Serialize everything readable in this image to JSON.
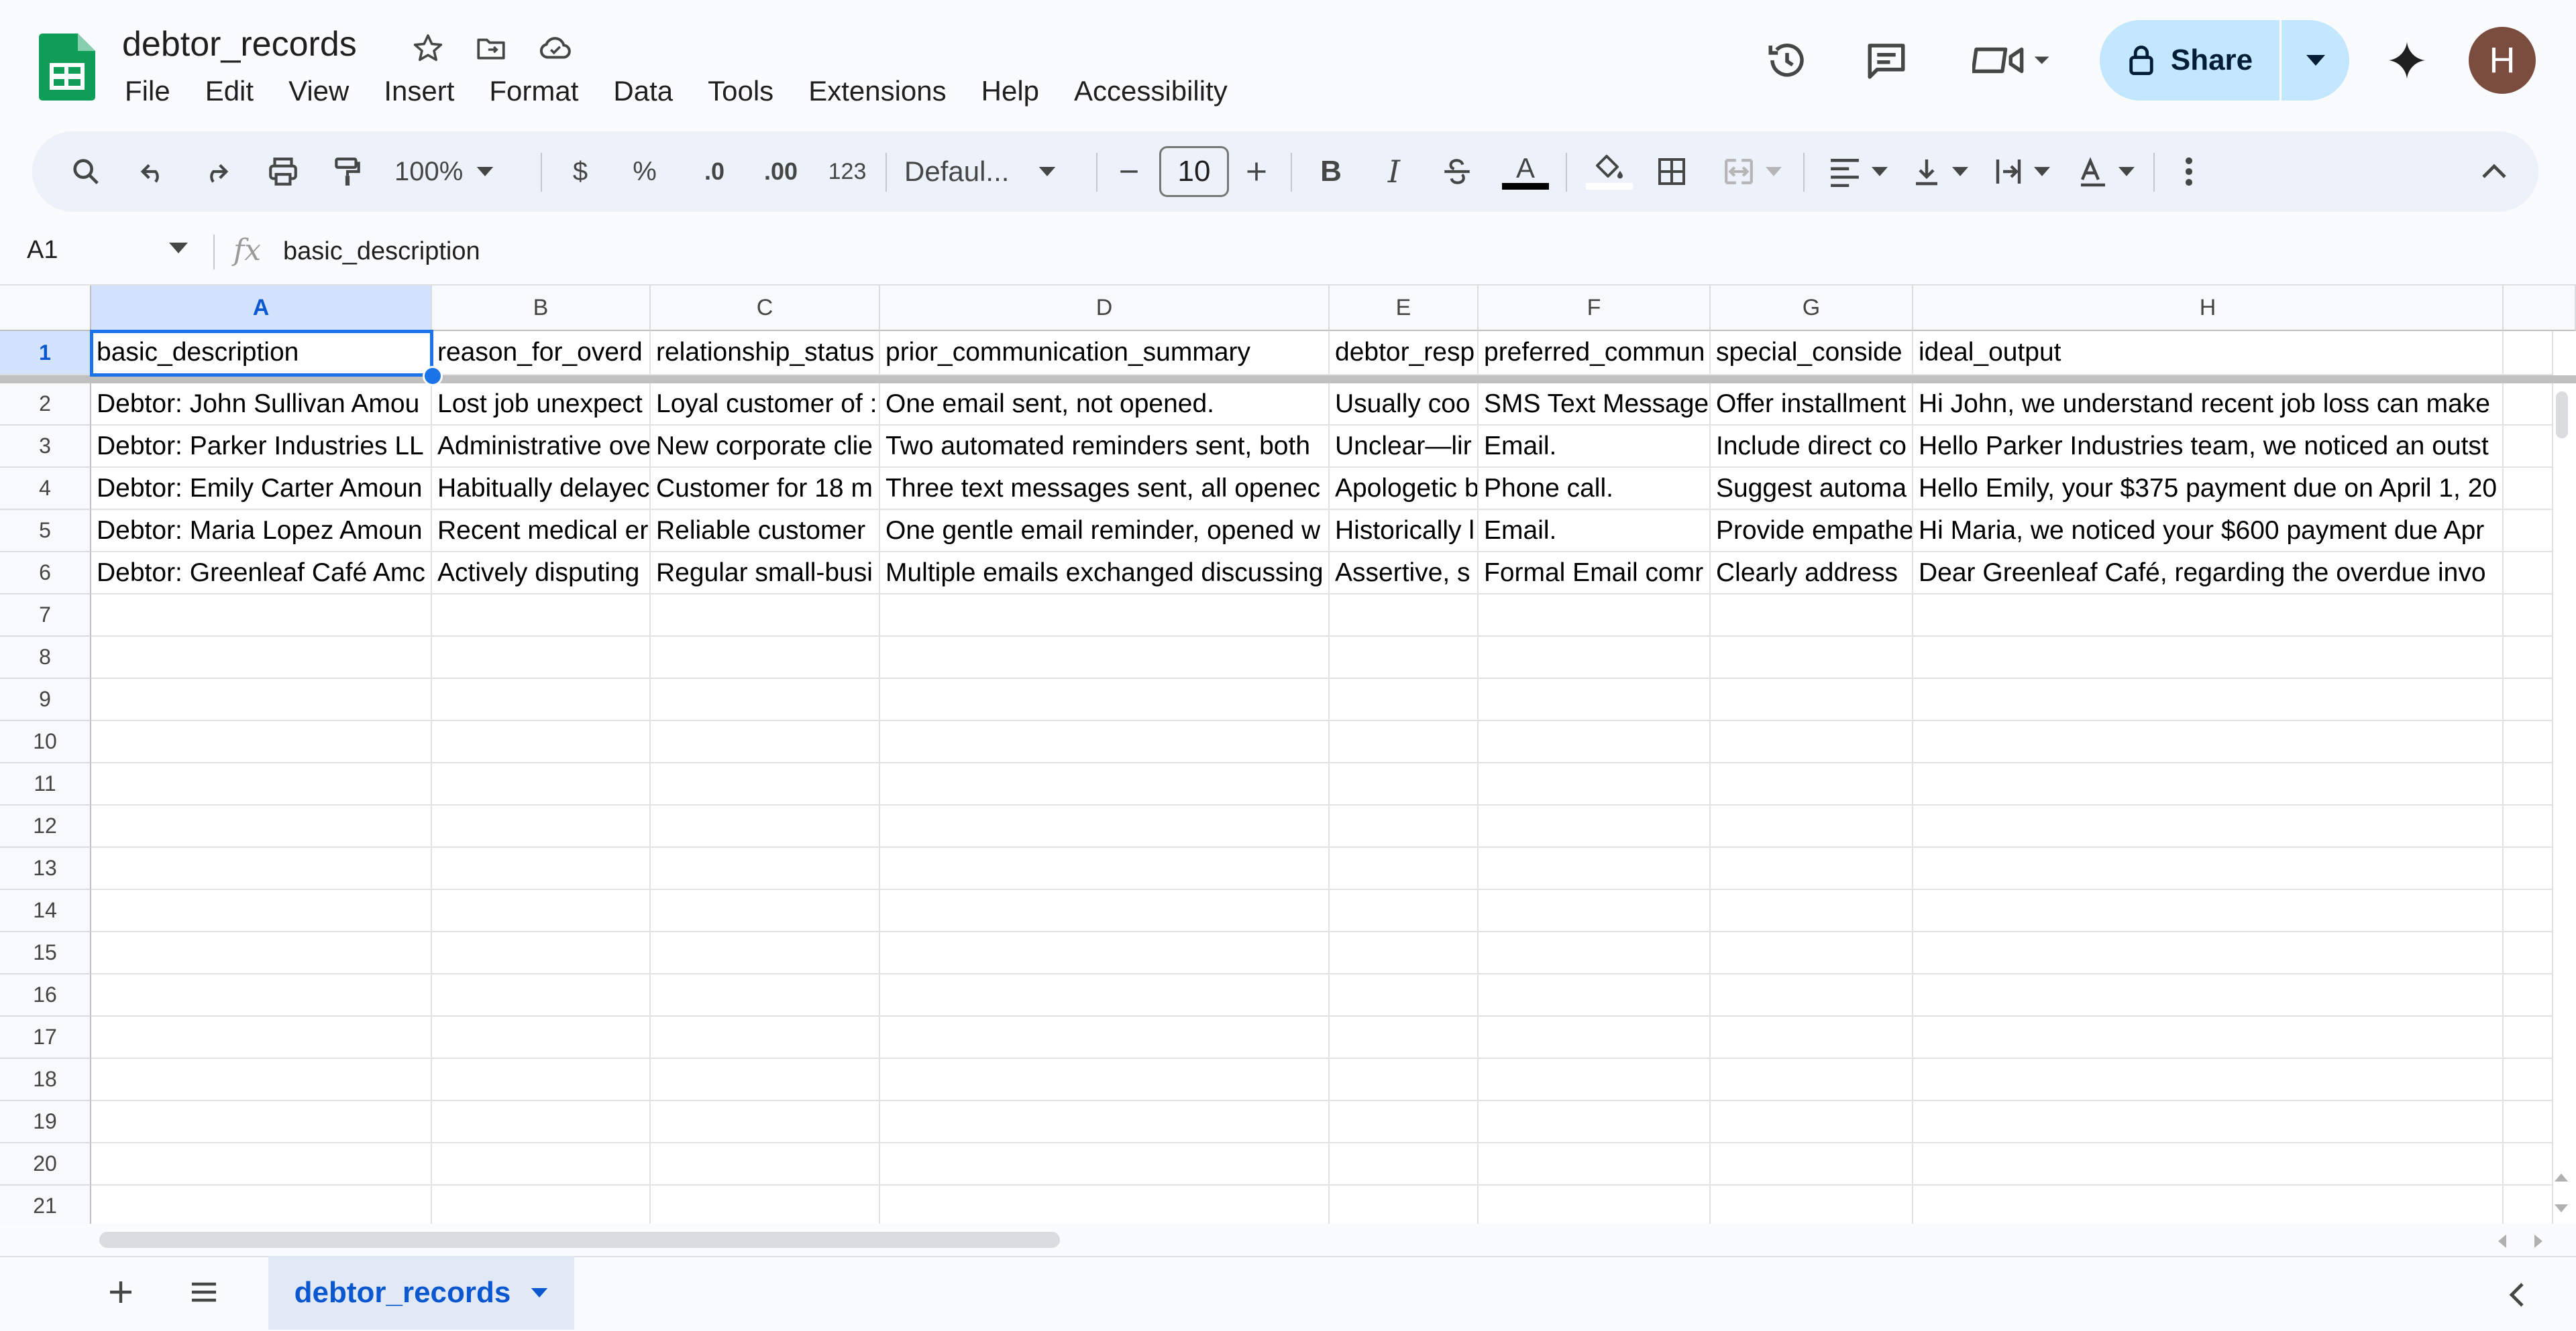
{
  "app": {
    "doc_title": "debtor_records",
    "avatar_letter": "H",
    "share_label": "Share"
  },
  "menu": [
    "File",
    "Edit",
    "View",
    "Insert",
    "Format",
    "Data",
    "Tools",
    "Extensions",
    "Help",
    "Accessibility"
  ],
  "toolbar": {
    "zoom": "100%",
    "currency": "$",
    "percent": "%",
    "decrease_decimal": ".0",
    "increase_decimal": ".00",
    "number_format": "123",
    "font": "Defaul...",
    "font_size": "10",
    "text_color_accent": "#000000"
  },
  "formula_bar": {
    "cell_ref": "A1",
    "fx": "fx",
    "value": "basic_description"
  },
  "grid": {
    "columns": [
      "A",
      "B",
      "C",
      "D",
      "E",
      "F",
      "G",
      "H"
    ],
    "row_numbers": [
      "1",
      "2",
      "3",
      "4",
      "5",
      "6",
      "7",
      "8",
      "9",
      "10",
      "11",
      "12",
      "13",
      "14",
      "15",
      "16",
      "17",
      "18",
      "19",
      "20",
      "21"
    ],
    "rows": [
      [
        "basic_description",
        "reason_for_overd",
        "relationship_status",
        "prior_communication_summary",
        "debtor_resp",
        "preferred_commun",
        "special_conside",
        "ideal_output"
      ],
      [
        "Debtor: John Sullivan Amou",
        "Lost job unexpect",
        "Loyal customer of :",
        "One email sent, not opened.",
        "Usually coo",
        "SMS Text Message",
        "Offer installment",
        "Hi John, we understand recent job loss can make"
      ],
      [
        "Debtor: Parker Industries LL",
        "Administrative ove",
        "New corporate clie",
        "Two automated reminders sent, both",
        "Unclear—lir",
        "Email.",
        "Include direct co",
        "Hello Parker Industries team, we noticed an outst"
      ],
      [
        "Debtor: Emily Carter Amoun",
        "Habitually delayec",
        "Customer for 18 m",
        "Three text messages sent, all openec",
        "Apologetic b",
        "Phone call.",
        "Suggest automa",
        "Hello Emily, your $375 payment due on April 1, 20"
      ],
      [
        "Debtor: Maria Lopez Amoun",
        "Recent medical er",
        "Reliable customer",
        "One gentle email reminder, opened w",
        "Historically l",
        "Email.",
        "Provide empathe",
        "Hi Maria, we noticed your $600 payment due Apr"
      ],
      [
        "Debtor: Greenleaf Café Amc",
        "Actively disputing",
        "Regular small-busi",
        "Multiple emails exchanged discussing",
        "Assertive, s",
        "Formal Email comr",
        "Clearly address",
        "Dear Greenleaf Café, regarding the overdue invo"
      ]
    ]
  },
  "sheet_tab": {
    "label": "debtor_records"
  },
  "colors": {
    "selection": "#1a73e8",
    "share_bg": "#c2e7ff",
    "toolbar_bg": "#edf2fa",
    "logo_green": "#0f9d58"
  }
}
